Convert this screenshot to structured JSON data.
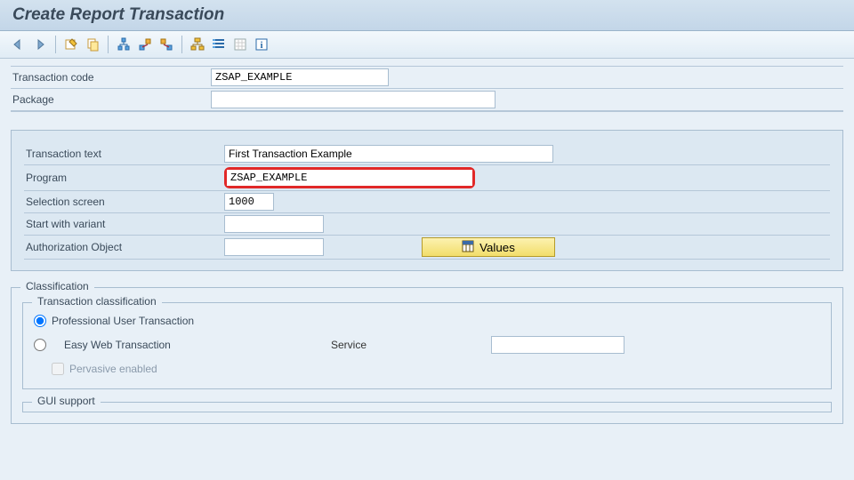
{
  "header": {
    "title": "Create Report Transaction"
  },
  "toolbar": {
    "icons": [
      "back-icon",
      "forward-icon",
      "sep",
      "display-toggle-icon",
      "copy-icon",
      "sep",
      "hierarchy-icon",
      "move-left-icon",
      "move-right-icon",
      "sep",
      "org-icon",
      "lines-icon",
      "grid-icon",
      "info-icon"
    ]
  },
  "top": {
    "transaction_code_label": "Transaction code",
    "transaction_code_value": "ZSAP_EXAMPLE",
    "package_label": "Package",
    "package_value": ""
  },
  "details": {
    "transaction_text_label": "Transaction text",
    "transaction_text_value": "First Transaction Example",
    "program_label": "Program",
    "program_value": "ZSAP_EXAMPLE",
    "selection_screen_label": "Selection screen",
    "selection_screen_value": "1000",
    "start_variant_label": "Start with variant",
    "start_variant_value": "",
    "auth_object_label": "Authorization Object",
    "auth_object_value": "",
    "values_button": "Values"
  },
  "classification": {
    "group_title": "Classification",
    "inner_title": "Transaction classification",
    "radio_pro": "Professional User Transaction",
    "radio_easy": "Easy Web Transaction",
    "service_label": "Service",
    "service_value": "",
    "pervasive_label": "Pervasive enabled",
    "gui_support_title": "GUI support"
  }
}
